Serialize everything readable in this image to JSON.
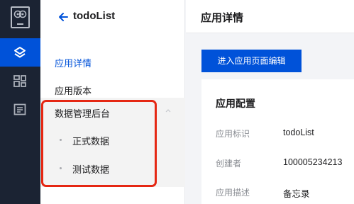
{
  "rail": {
    "items": [
      {
        "icon": "logo-icon"
      },
      {
        "icon": "layers-icon",
        "active": true
      },
      {
        "icon": "dashboard-icon"
      },
      {
        "icon": "document-list-icon"
      }
    ]
  },
  "nav": {
    "back_icon": "arrow-left-icon",
    "app_title": "todoList",
    "items": [
      {
        "label": "应用详情",
        "active": true
      },
      {
        "label": "应用版本"
      }
    ],
    "group": {
      "label": "数据管理后台",
      "expanded": true,
      "children": [
        {
          "label": "正式数据"
        },
        {
          "label": "测试数据"
        }
      ]
    },
    "highlight_color": "#e52713"
  },
  "main": {
    "header_title": "应用详情",
    "edit_button_label": "进入应用页面编辑",
    "card": {
      "title": "应用配置",
      "fields": [
        {
          "key": "应用标识",
          "value": "todoList"
        },
        {
          "key": "创建者",
          "value": "100005234213"
        },
        {
          "key": "应用描述",
          "value": "备忘录"
        }
      ]
    }
  },
  "colors": {
    "rail_bg": "#1b2333",
    "accent": "#0052d9"
  }
}
